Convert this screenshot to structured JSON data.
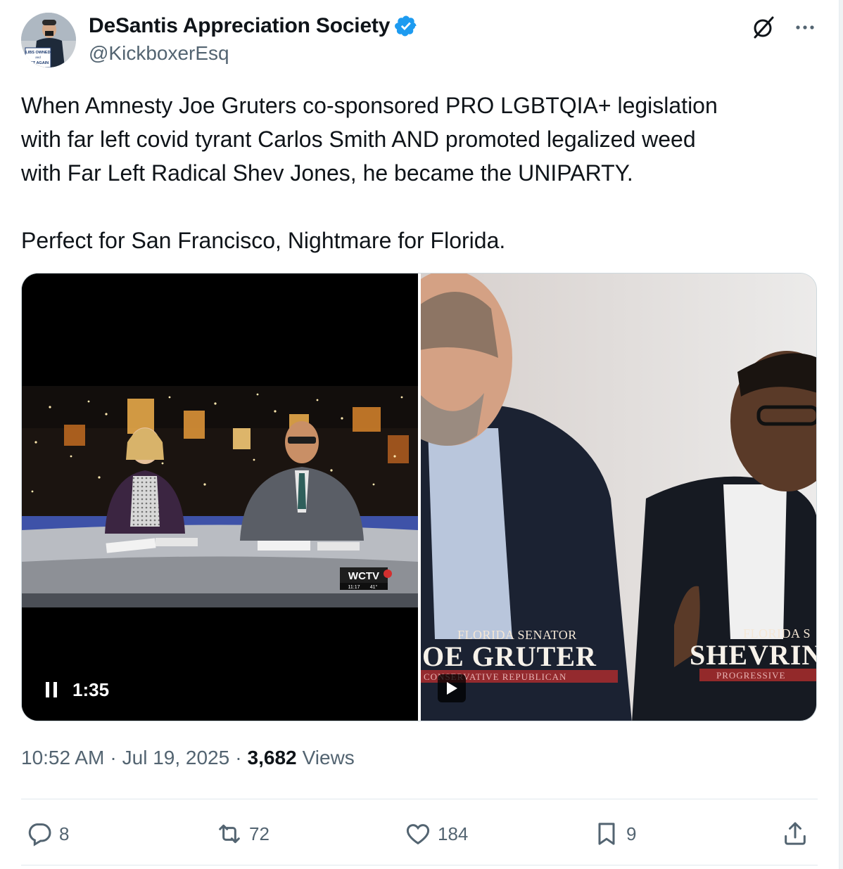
{
  "author": {
    "display_name": "DeSantis Appreciation Society",
    "handle": "@KickboxerEsq",
    "avatar_sign_text": "LIBS OWNED\nand\nGET AGAIN"
  },
  "icons": {
    "verified": "verified-badge-icon",
    "grok": "grok-icon",
    "more": "more-icon",
    "reply": "reply-icon",
    "retweet": "retweet-icon",
    "like": "heart-icon",
    "bookmark": "bookmark-icon",
    "share": "share-icon"
  },
  "colors": {
    "verified_blue": "#1d9bf0",
    "text_primary": "#0f1419",
    "text_secondary": "#536471"
  },
  "tweet": {
    "line1": "When Amnesty Joe Gruters co-sponsored PRO LGBTQIA+ legislation",
    "line2": "with far left covid tyrant Carlos Smith AND promoted legalized weed",
    "line3": "with Far Left Radical Shev Jones,  he became the UNIPARTY.",
    "line4": "Perfect for San Francisco, Nightmare for Florida."
  },
  "media": {
    "video1": {
      "duration": "1:35",
      "channel_logo": "WCTV",
      "logo_time": "11:17",
      "logo_temp": "41°"
    },
    "video2": {
      "lower_third_left_title": "FLORIDA SENATOR",
      "lower_third_left_name": "OE GRUTER",
      "lower_third_left_sub": "CONSERVATIVE REPUBLICAN",
      "lower_third_right_title": "FLORIDA S",
      "lower_third_right_name": "SHEVRIN",
      "lower_third_right_sub": "PROGRESSIVE"
    }
  },
  "meta": {
    "time": "10:52 AM",
    "separator": "·",
    "date": "Jul 19, 2025",
    "views_count": "3,682",
    "views_label": "Views"
  },
  "actions": {
    "replies": "8",
    "retweets": "72",
    "likes": "184",
    "bookmarks": "9"
  }
}
